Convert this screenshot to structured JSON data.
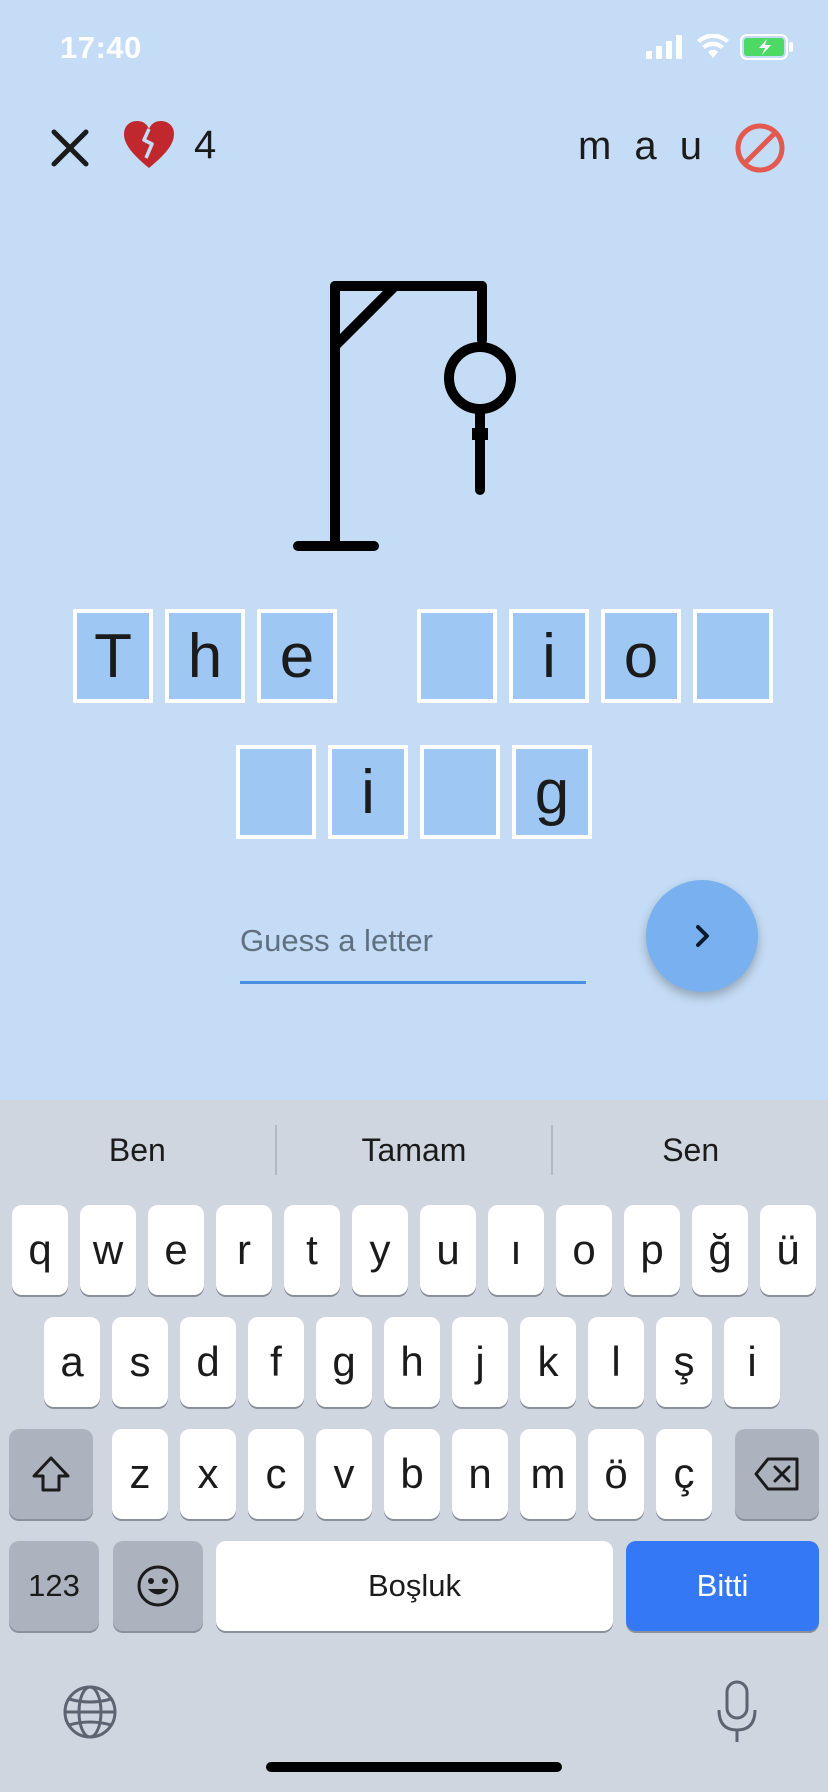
{
  "status_bar": {
    "time": "17:40"
  },
  "header": {
    "lives": "4",
    "used_letters": "m a u"
  },
  "word": {
    "row1": [
      "T",
      "h",
      "e",
      " ",
      "",
      "i",
      "o",
      ""
    ],
    "row2": [
      "",
      "i",
      "",
      "g"
    ]
  },
  "guess": {
    "placeholder": "Guess a letter",
    "value": ""
  },
  "keyboard": {
    "suggestions": [
      "Ben",
      "Tamam",
      "Sen"
    ],
    "row1": [
      "q",
      "w",
      "e",
      "r",
      "t",
      "y",
      "u",
      "ı",
      "o",
      "p",
      "ğ",
      "ü"
    ],
    "row2": [
      "a",
      "s",
      "d",
      "f",
      "g",
      "h",
      "j",
      "k",
      "l",
      "ş",
      "i"
    ],
    "row3": [
      "z",
      "x",
      "c",
      "v",
      "b",
      "n",
      "m",
      "ö",
      "ç"
    ],
    "numbers_key": "123",
    "space_key": "Boşluk",
    "done_key": "Bitti"
  },
  "colors": {
    "background": "#c4dcf5",
    "tile": "#9ec8f3",
    "accent": "#79b0ef",
    "heart": "#c0282d",
    "wrong": "#e25a4f",
    "done_key": "#3478f6"
  },
  "icons": {
    "close": "close-icon",
    "lives": "broken-heart-icon",
    "wrong_letters": "prohibited-icon",
    "submit": "chevron-right-icon"
  }
}
